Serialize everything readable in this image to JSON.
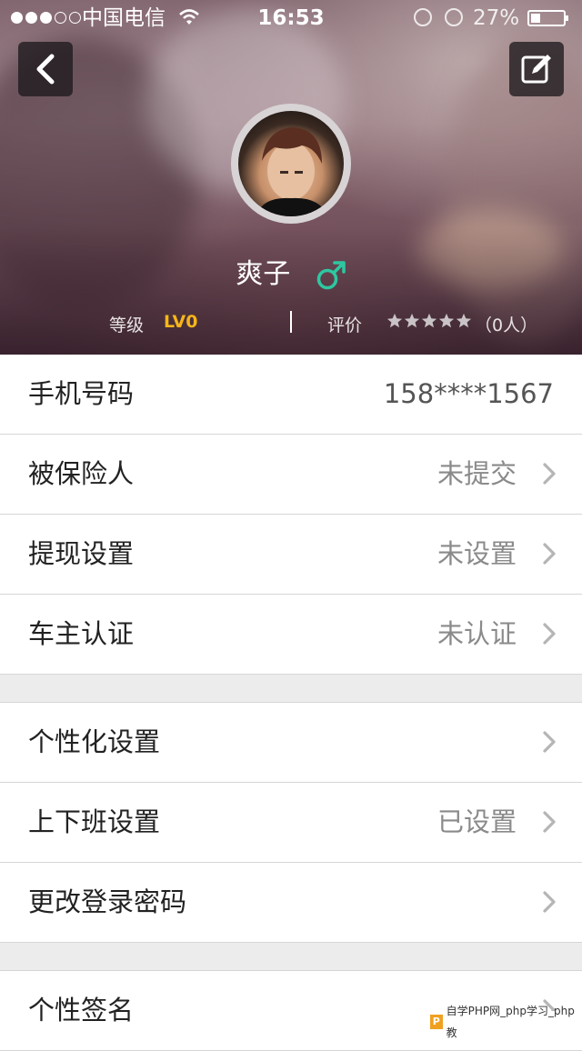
{
  "status_bar": {
    "carrier": "中国电信",
    "time": "16:53",
    "battery": "27%"
  },
  "profile": {
    "name": "爽子",
    "gender": "male",
    "level_label": "等级",
    "level_value": "LV0",
    "rating_label": "评价",
    "rating_stars": 0,
    "rating_count": "（0人）"
  },
  "colors": {
    "gender_icon": "#2ec7a0",
    "level_accent": "#f5b61a"
  },
  "list": {
    "phone": {
      "label": "手机号码",
      "value": "158****1567"
    },
    "insured": {
      "label": "被保险人",
      "value": "未提交"
    },
    "withdraw": {
      "label": "提现设置",
      "value": "未设置"
    },
    "owner_auth": {
      "label": "车主认证",
      "value": "未认证"
    },
    "personalize": {
      "label": "个性化设置",
      "value": ""
    },
    "commute": {
      "label": "上下班设置",
      "value": "已设置"
    },
    "password": {
      "label": "更改登录密码",
      "value": ""
    },
    "signature": {
      "label": "个性签名",
      "value": ""
    }
  },
  "watermark": {
    "text": "自学PHP网_php学习_php教"
  }
}
